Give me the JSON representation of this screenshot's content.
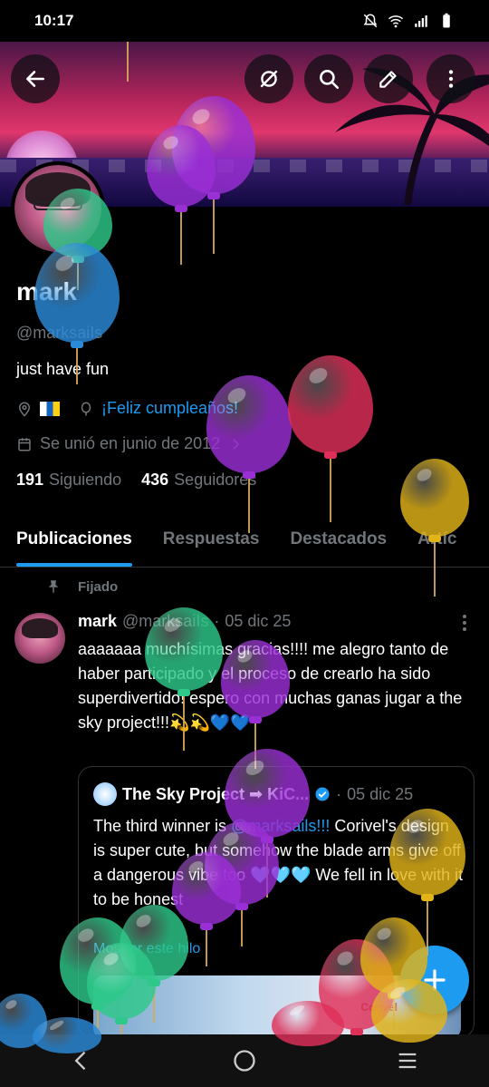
{
  "status_bar": {
    "time": "10:17"
  },
  "profile": {
    "name": "mark",
    "handle": "@marksaiIs",
    "bio": "just have fun",
    "birthday_link": "¡Feliz cumpleaños!",
    "joined": "Se unió en junio de 2012",
    "following_count": "191",
    "following_label": "Siguiendo",
    "followers_count": "436",
    "followers_label": "Seguidores"
  },
  "tabs": [
    "Publicaciones",
    "Respuestas",
    "Destacados",
    "Artíc"
  ],
  "pinned_label": "Fijado",
  "post": {
    "name": "mark",
    "handle": "@marksaiIs",
    "separator": "·",
    "date": "05 dic 25",
    "text": "aaaaaaa muchísimas gracias!!!! me alegro tanto de haber participado y el proceso de crearlo ha sido superdivertido! espero con muchas ganas jugar a the sky project!!!💫💫💙💙"
  },
  "quote": {
    "name": "The Sky Project ➡ KiC...",
    "separator": "·",
    "date": "05 dic 25",
    "text_before": "The third winner is ",
    "mention": "@marksails!!!",
    "text_after": " Corivel's design is super cute, but somehow the blade arms give off a dangerous vibe too 🩵🩵🩵 We fell in love with it to be honest",
    "thread_link": "Mostrar este hilo",
    "image_tag": "Corivel"
  },
  "colors": {
    "accent": "#1d9bf0",
    "balloon_purple": "#9b2fd6",
    "balloon_green": "#2ec98a",
    "balloon_blue": "#2b8ad8",
    "balloon_red": "#e0305a",
    "balloon_yellow": "#e2b418"
  }
}
